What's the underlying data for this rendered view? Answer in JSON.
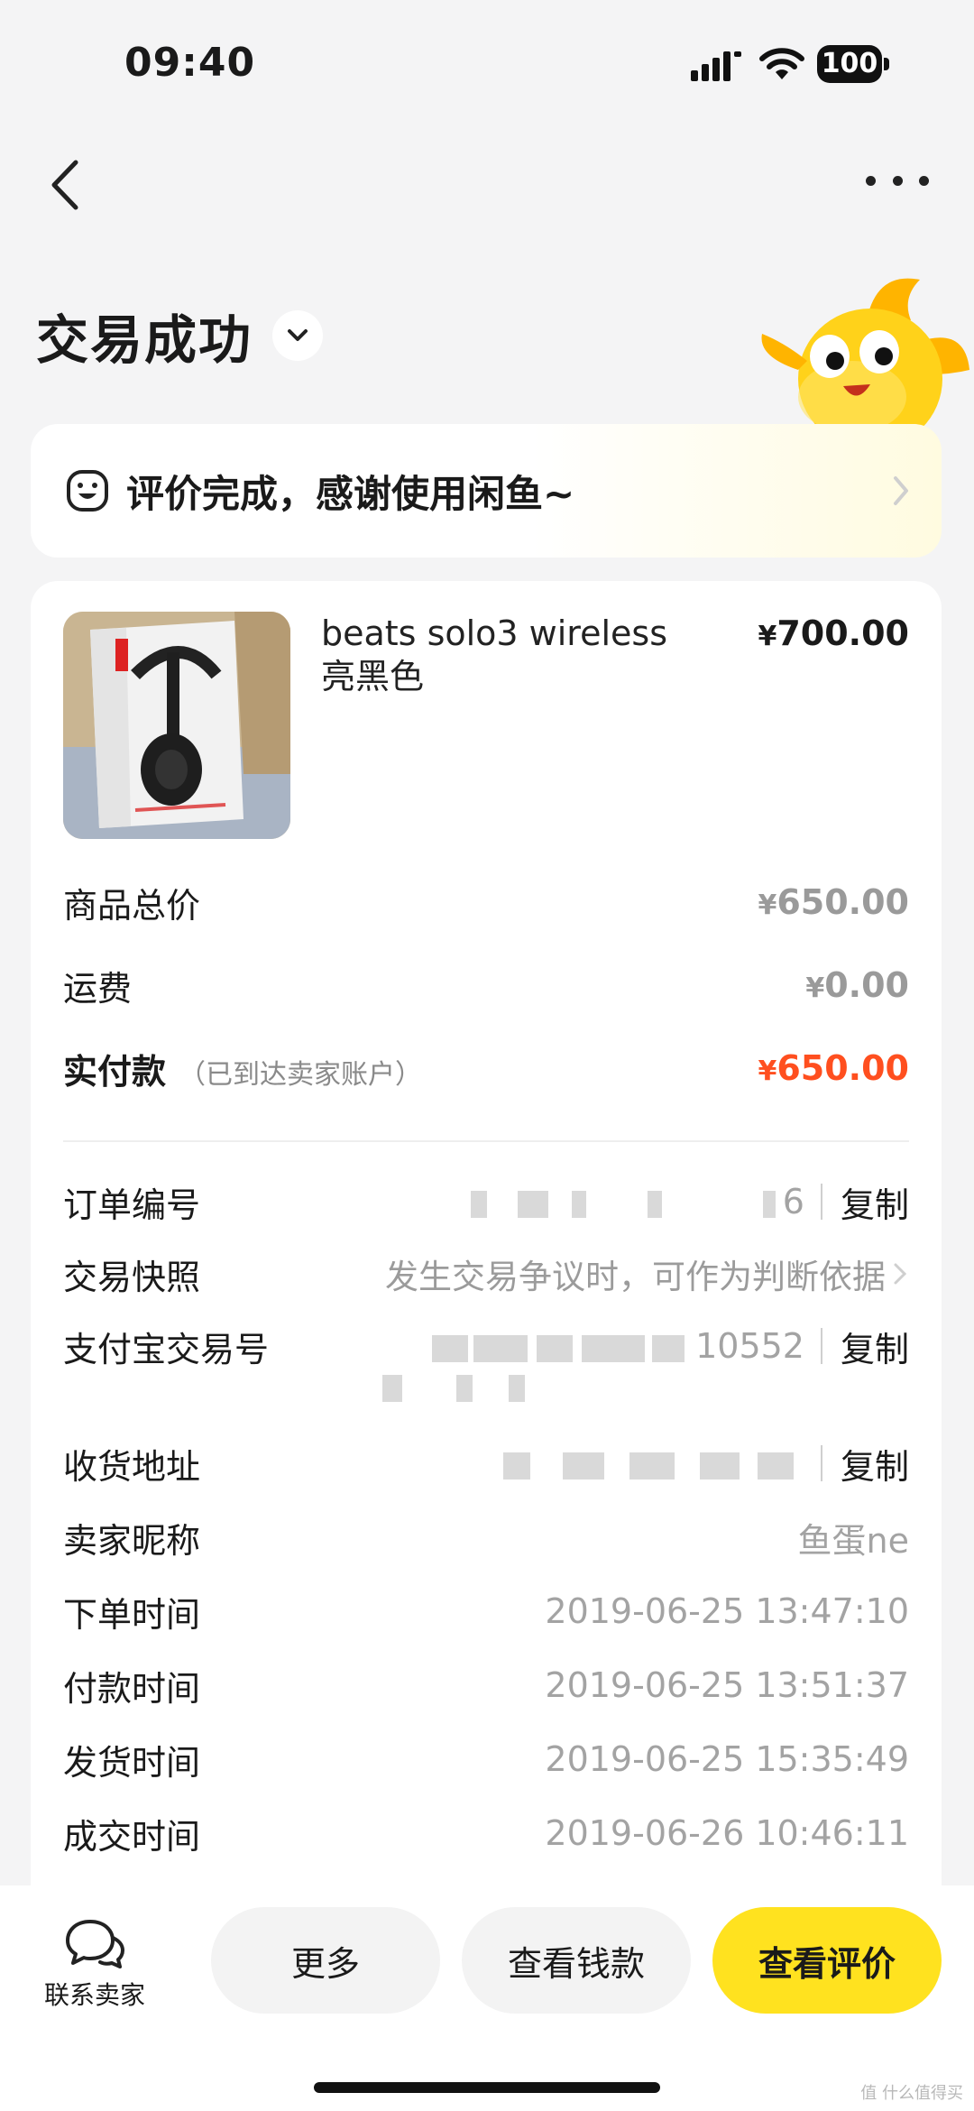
{
  "status_bar": {
    "time": "09:40",
    "battery": "100"
  },
  "header": {
    "title": "交易成功"
  },
  "notice": {
    "text": "评价完成，感谢使用闲鱼~"
  },
  "product": {
    "name": "beats solo3 wireless 亮黑色",
    "price_symbol": "¥",
    "price": "700.00"
  },
  "summary": {
    "goods_total_label": "商品总价",
    "goods_total_symbol": "¥",
    "goods_total": "650.00",
    "shipping_label": "运费",
    "shipping_symbol": "¥",
    "shipping": "0.00",
    "paid_label": "实付款",
    "paid_note": "（已到达卖家账户）",
    "paid_symbol": "¥",
    "paid": "650.00"
  },
  "details": {
    "order_no_label": "订单编号",
    "order_no_tail": "6",
    "snapshot_label": "交易快照",
    "snapshot_value": "发生交易争议时，可作为判断依据",
    "alipay_label": "支付宝交易号",
    "alipay_tail": "10552",
    "address_label": "收货地址",
    "seller_label": "卖家昵称",
    "seller_value": "鱼蛋ne",
    "order_time_label": "下单时间",
    "order_time": "2019-06-25 13:47:10",
    "pay_time_label": "付款时间",
    "pay_time": "2019-06-25 13:51:37",
    "ship_time_label": "发货时间",
    "ship_time": "2019-06-25 15:35:49",
    "deal_time_label": "成交时间",
    "deal_time": "2019-06-26 10:46:11",
    "copy_label": "复制"
  },
  "bottom_bar": {
    "contact_label": "联系卖家",
    "more_label": "更多",
    "money_label": "查看钱款",
    "review_label": "查看评价"
  },
  "watermark": "值 什么值得买",
  "colors": {
    "accent_yellow": "#ffe21f",
    "paid_red": "#ff4f1f",
    "muted": "#9a9a9a"
  },
  "icons": [
    "back-arrow",
    "more-dots",
    "chevron-down",
    "smile-face",
    "chevron-right",
    "chat-bubbles",
    "mascot-fish"
  ]
}
